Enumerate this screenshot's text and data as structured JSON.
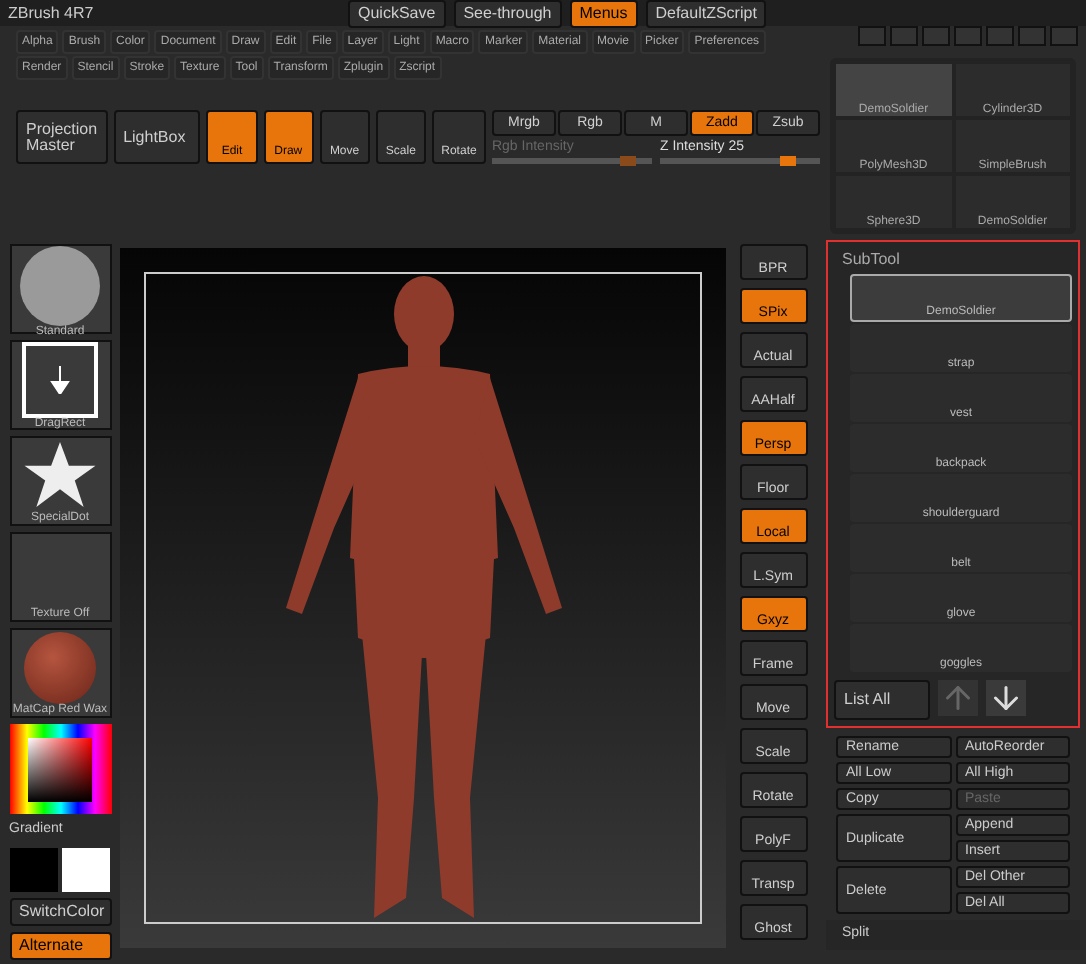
{
  "title": "ZBrush 4R7",
  "top_buttons": [
    {
      "label": "QuickSave",
      "selected": false
    },
    {
      "label": "See-through",
      "selected": false
    },
    {
      "label": "Menus",
      "selected": true
    },
    {
      "label": "DefaultZScript",
      "selected": false
    }
  ],
  "menus": [
    [
      "Alpha",
      "Brush",
      "Color",
      "Document",
      "Draw",
      "Edit",
      "File",
      "Layer",
      "Light",
      "Macro",
      "Marker",
      "Material",
      "Movie",
      "Picker",
      "Preferences"
    ],
    [
      "Render",
      "Stencil",
      "Stroke",
      "Texture",
      "Tool",
      "Transform",
      "Zplugin",
      "Zscript"
    ]
  ],
  "toolbar": {
    "big_buttons": [
      "Projection Master",
      "LightBox"
    ],
    "modes": [
      {
        "label": "Edit",
        "selected": true
      },
      {
        "label": "Draw",
        "selected": true
      },
      {
        "label": "Move",
        "selected": false
      },
      {
        "label": "Scale",
        "selected": false
      },
      {
        "label": "Rotate",
        "selected": false
      }
    ],
    "channels": [
      {
        "label": "Mrgb",
        "selected": false
      },
      {
        "label": "Rgb",
        "selected": false
      },
      {
        "label": "M",
        "selected": false
      },
      {
        "label": "Zadd",
        "selected": true
      },
      {
        "label": "Zsub",
        "selected": false
      }
    ],
    "sliders": [
      {
        "label": "Rgb Intensity",
        "disabled": true,
        "level": 0.9
      },
      {
        "label": "Z Intensity 25",
        "disabled": false,
        "level": 0.85
      }
    ]
  },
  "left_panel": [
    {
      "kind": "brush",
      "label": "Standard"
    },
    {
      "kind": "stroke",
      "label": "DragRect"
    },
    {
      "kind": "alpha",
      "label": "SpecialDot"
    },
    {
      "kind": "texture",
      "label": "Texture Off"
    },
    {
      "kind": "material",
      "label": "MatCap Red Wax"
    },
    {
      "kind": "picker",
      "label": "Gradient"
    },
    {
      "kind": "swatches"
    },
    {
      "kind": "button",
      "label": "SwitchColor",
      "selected": false
    },
    {
      "kind": "button",
      "label": "Alternate",
      "selected": true
    }
  ],
  "shelf": [
    {
      "label": "BPR",
      "selected": false
    },
    {
      "label": "SPix",
      "selected": true
    },
    {
      "label": "Actual",
      "selected": false
    },
    {
      "label": "AAHalf",
      "selected": false
    },
    {
      "label": "Persp",
      "selected": true
    },
    {
      "label": "Floor",
      "selected": false
    },
    {
      "label": "Local",
      "selected": true
    },
    {
      "label": "L.Sym",
      "selected": false
    },
    {
      "label": "Gxyz",
      "selected": true
    },
    {
      "label": "Frame",
      "selected": false
    },
    {
      "label": "Move",
      "selected": false
    },
    {
      "label": "Scale",
      "selected": false
    },
    {
      "label": "Rotate",
      "selected": false
    },
    {
      "label": "PolyF",
      "selected": false
    },
    {
      "label": "Transp",
      "selected": false
    },
    {
      "label": "Ghost",
      "selected": false
    }
  ],
  "tools": [
    {
      "label": "DemoSoldier",
      "selected": true
    },
    {
      "label": "Cylinder3D",
      "selected": false
    },
    {
      "label": "PolyMesh3D",
      "selected": false
    },
    {
      "label": "SimpleBrush",
      "selected": false
    },
    {
      "label": "Sphere3D",
      "selected": false
    },
    {
      "label": "DemoSoldier",
      "selected": false
    }
  ],
  "subtool": {
    "title": "SubTool",
    "items": [
      {
        "label": "DemoSoldier",
        "selected": true
      },
      {
        "label": "strap",
        "selected": false
      },
      {
        "label": "vest",
        "selected": false
      },
      {
        "label": "backpack",
        "selected": false
      },
      {
        "label": "shoulderguard",
        "selected": false
      },
      {
        "label": "belt",
        "selected": false
      },
      {
        "label": "glove",
        "selected": false
      },
      {
        "label": "goggles",
        "selected": false
      }
    ],
    "list_all": "List All"
  },
  "actions": [
    {
      "label": "Rename",
      "disabled": false
    },
    {
      "label": "AutoReorder",
      "disabled": false
    },
    {
      "label": "All Low",
      "disabled": false
    },
    {
      "label": "All High",
      "disabled": false
    },
    {
      "label": "Copy",
      "disabled": false
    },
    {
      "label": "Paste",
      "disabled": true
    }
  ],
  "actions2": {
    "left": [
      "Duplicate",
      "Delete"
    ],
    "right": [
      "Append",
      "Insert",
      "Del Other",
      "Del All"
    ]
  },
  "split": "Split"
}
